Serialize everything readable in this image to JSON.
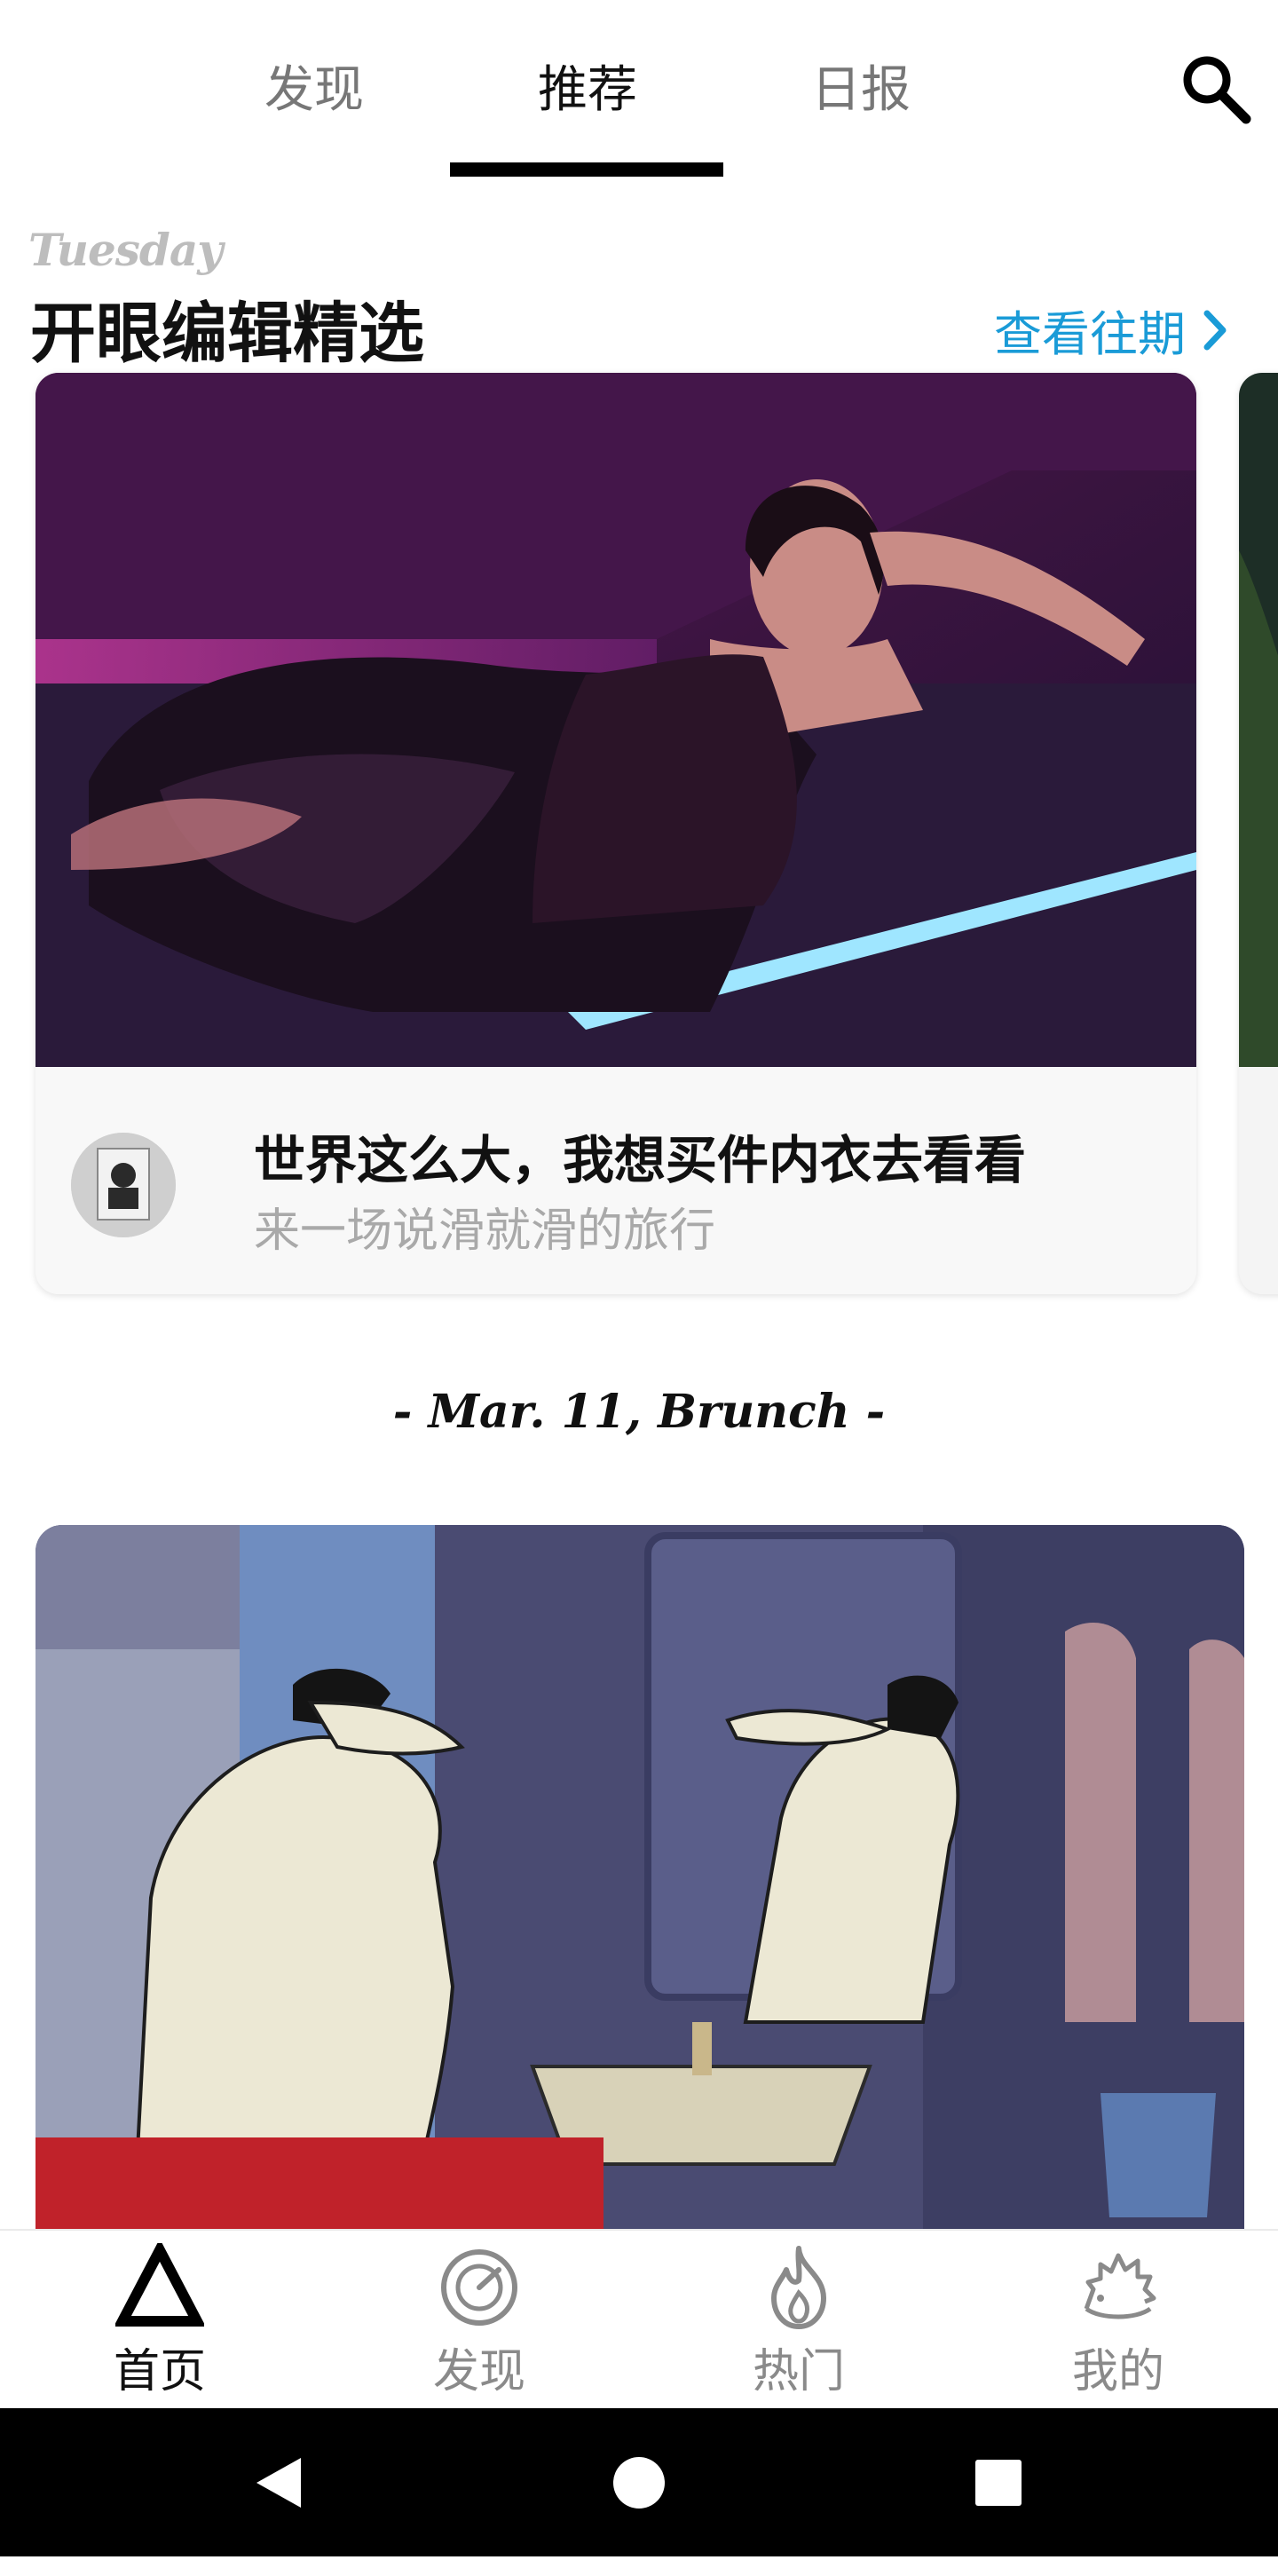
{
  "top_tabs": [
    {
      "label": "发现",
      "active": false
    },
    {
      "label": "推荐",
      "active": true
    },
    {
      "label": "日报",
      "active": false
    }
  ],
  "search_icon": "search-icon",
  "section": {
    "weekday": "Tuesday",
    "title": "开眼编辑精选",
    "history_link": "查看往期"
  },
  "featured_card": {
    "title": "世界这么大，我想买件内衣去看看",
    "subtitle": "来一场说滑就滑的旅行"
  },
  "date_divider": "- Mar. 11, Brunch -",
  "bottom_nav": [
    {
      "label": "首页",
      "icon": "home-triangle-icon",
      "active": true
    },
    {
      "label": "发现",
      "icon": "discover-dial-icon",
      "active": false
    },
    {
      "label": "热门",
      "icon": "flame-icon",
      "active": false
    },
    {
      "label": "我的",
      "icon": "hedgehog-icon",
      "active": false
    }
  ],
  "colors": {
    "accent": "#1a9bd7",
    "active_text": "#111111",
    "inactive_text": "#8a8a8a"
  }
}
